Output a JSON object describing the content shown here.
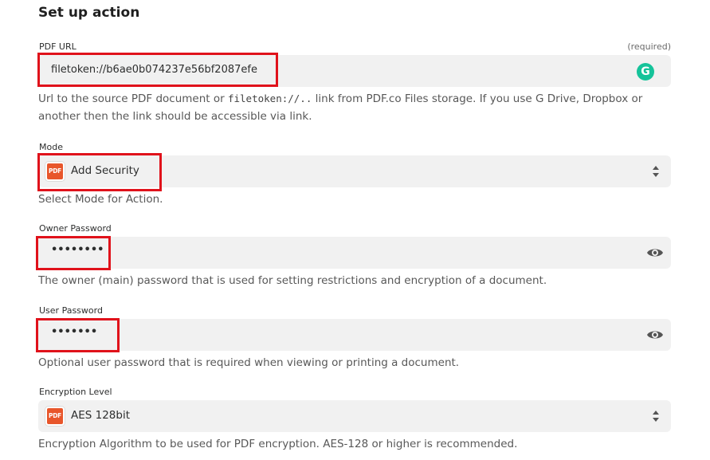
{
  "section": {
    "title": "Set up action"
  },
  "fields": {
    "pdf_url": {
      "label": "PDF URL",
      "required_label": "(required)",
      "value": "filetoken://b6ae0b074237e56bf2087efe",
      "helper_prefix": "Url to the source PDF document or ",
      "helper_code": "filetoken://..",
      "helper_suffix": " link from PDF.co Files storage. If you use G Drive, Dropbox or another then the link should be accessible via link.",
      "assist_icon": "grammarly-icon",
      "assist_glyph": "G"
    },
    "mode": {
      "label": "Mode",
      "app_icon_text": "PDF",
      "value": "Add Security",
      "helper": "Select Mode for Action."
    },
    "owner_password": {
      "label": "Owner Password",
      "value": "••••••••",
      "helper": "The owner (main) password that is used for setting restrictions and encryption of a document."
    },
    "user_password": {
      "label": "User Password",
      "value": "•••••••",
      "helper": "Optional user password that is required when viewing or printing a document."
    },
    "encryption_level": {
      "label": "Encryption Level",
      "app_icon_text": "PDF",
      "value": "AES 128bit",
      "helper": "Encryption Algorithm to be used for PDF encryption. AES-128 or higher is recommended."
    }
  },
  "colors": {
    "highlight": "#e0121b",
    "input_bg": "#f1f1f1",
    "app_icon": "#e8562b",
    "grammarly": "#15c39a"
  }
}
